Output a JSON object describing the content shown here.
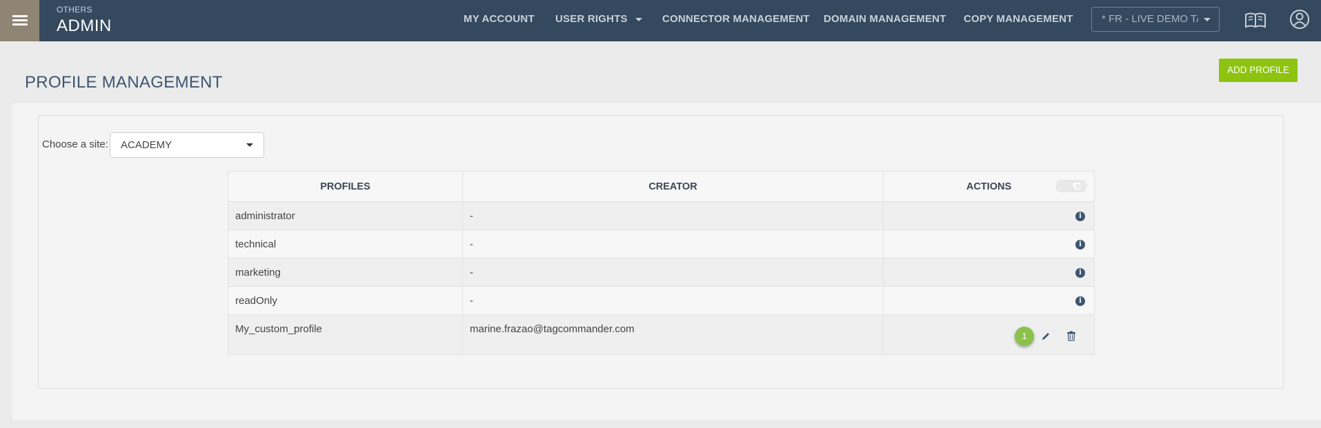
{
  "header": {
    "section_label": "OTHERS",
    "app_title": "ADMIN",
    "nav": [
      {
        "label": "MY ACCOUNT"
      },
      {
        "label": "USER RIGHTS"
      },
      {
        "label": "CONNECTOR MANAGEMENT"
      },
      {
        "label": "DOMAIN MANAGEMENT"
      },
      {
        "label": "COPY MANAGEMENT"
      }
    ],
    "site_selector_value": "* FR - LIVE DEMO TAGCOMMANDER",
    "icons": [
      "menu-icon",
      "book-icon",
      "user-icon"
    ]
  },
  "page": {
    "title": "PROFILE MANAGEMENT",
    "add_button": "ADD PROFILE",
    "site_filter": {
      "label": "Choose a site:",
      "value": "ACADEMY"
    }
  },
  "table": {
    "columns": [
      "PROFILES",
      "CREATOR",
      "ACTIONS"
    ],
    "trash_count": "0",
    "rows": [
      {
        "profile": "administrator",
        "creator": "-"
      },
      {
        "profile": "technical",
        "creator": "-"
      },
      {
        "profile": "marketing",
        "creator": "-"
      },
      {
        "profile": "readOnly",
        "creator": "-"
      },
      {
        "profile": "My_custom_profile",
        "creator": "marine.frazao@tagcommander.com",
        "badge": "1"
      }
    ]
  },
  "colors": {
    "topbar": "#34495e",
    "menu_button": "#8f8574",
    "accent_green": "#8ec411",
    "badge_green": "#8bc34a"
  }
}
